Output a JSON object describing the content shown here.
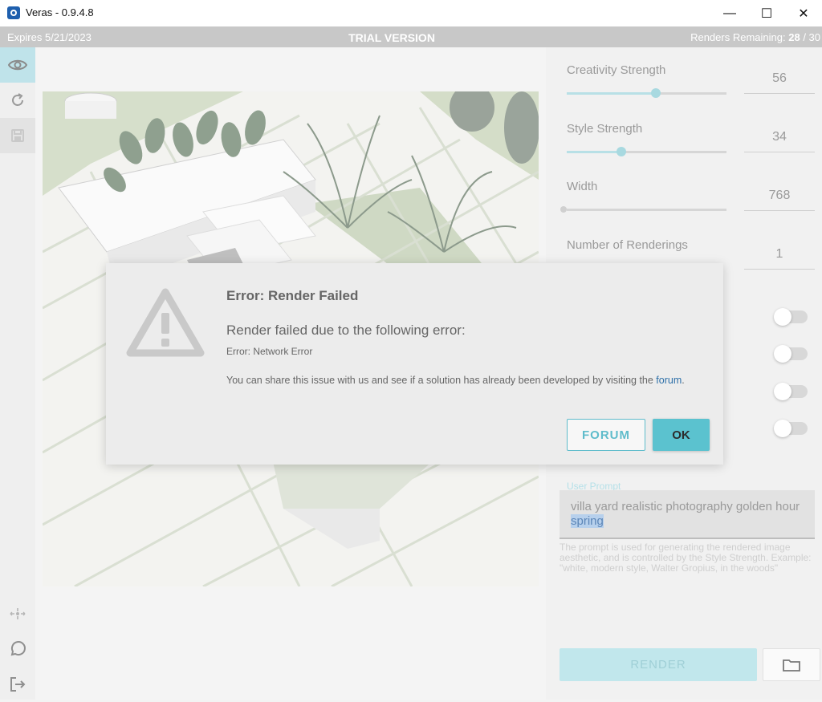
{
  "window": {
    "title": "Veras - 0.9.4.8",
    "minimize": "—",
    "maximize": "☐",
    "close": "✕"
  },
  "trial_bar": {
    "expires": "Expires 5/21/2023",
    "label": "TRIAL VERSION",
    "renders_label": "Renders Remaining:",
    "renders_used": "28",
    "renders_total": "/ 30"
  },
  "rail": {
    "icons": [
      "eye-icon",
      "refresh-icon",
      "save-icon",
      "move-icon",
      "chat-icon",
      "exit-icon"
    ]
  },
  "settings": {
    "creativity": {
      "label": "Creativity Strength",
      "value": "56",
      "fraction": 0.56
    },
    "style": {
      "label": "Style Strength",
      "value": "34",
      "fraction": 0.34
    },
    "width": {
      "label": "Width",
      "value": "768",
      "fraction": 0.0
    },
    "renderings": {
      "label": "Number of Renderings",
      "value": "1",
      "fraction": 0.0
    }
  },
  "prompt": {
    "label": "User Prompt",
    "text": "villa yard  realistic photography  golden hour ",
    "selected": "spring",
    "help": "The prompt is used for generating the rendered image aesthetic, and is controlled by the Style Strength. Example: \"white, modern style, Walter Gropius, in the woods\""
  },
  "render_button": "RENDER",
  "dialog": {
    "title": "Error: Render Failed",
    "heading": "Render failed due to the following error:",
    "error": "Error: Network Error",
    "message": "You can share this issue with us and see if a solution has already been developed by visiting the ",
    "link": "forum",
    "period": ".",
    "forum_button": "FORUM",
    "ok_button": "OK"
  },
  "colors": {
    "accent": "#5bc2cf",
    "trial_bar": "#c8c8c8",
    "link": "#2d6fa8"
  }
}
